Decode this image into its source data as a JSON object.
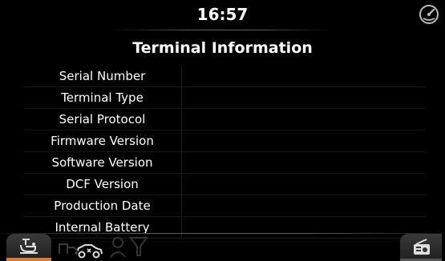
{
  "status": {
    "time": "16:57",
    "corner_icon": "gauge-settings-icon"
  },
  "page": {
    "title": "Terminal Information"
  },
  "rows": [
    {
      "label": "Serial Number",
      "value": ""
    },
    {
      "label": "Terminal Type",
      "value": ""
    },
    {
      "label": "Serial Protocol",
      "value": ""
    },
    {
      "label": "Firmware Version",
      "value": ""
    },
    {
      "label": "Software Version",
      "value": ""
    },
    {
      "label": "DCF Version",
      "value": ""
    },
    {
      "label": "Production Date",
      "value": ""
    },
    {
      "label": "Internal Battery",
      "value": ""
    }
  ],
  "bottom_nav": {
    "left_tab_icon": "machine-settings-icon",
    "icons": [
      "car-settings-icon",
      "ghost-truck-icon",
      "ghost-person-icon",
      "ghost-filter-icon"
    ],
    "right_tab_icon": "radio-icon",
    "accent_color": "#e87820"
  }
}
